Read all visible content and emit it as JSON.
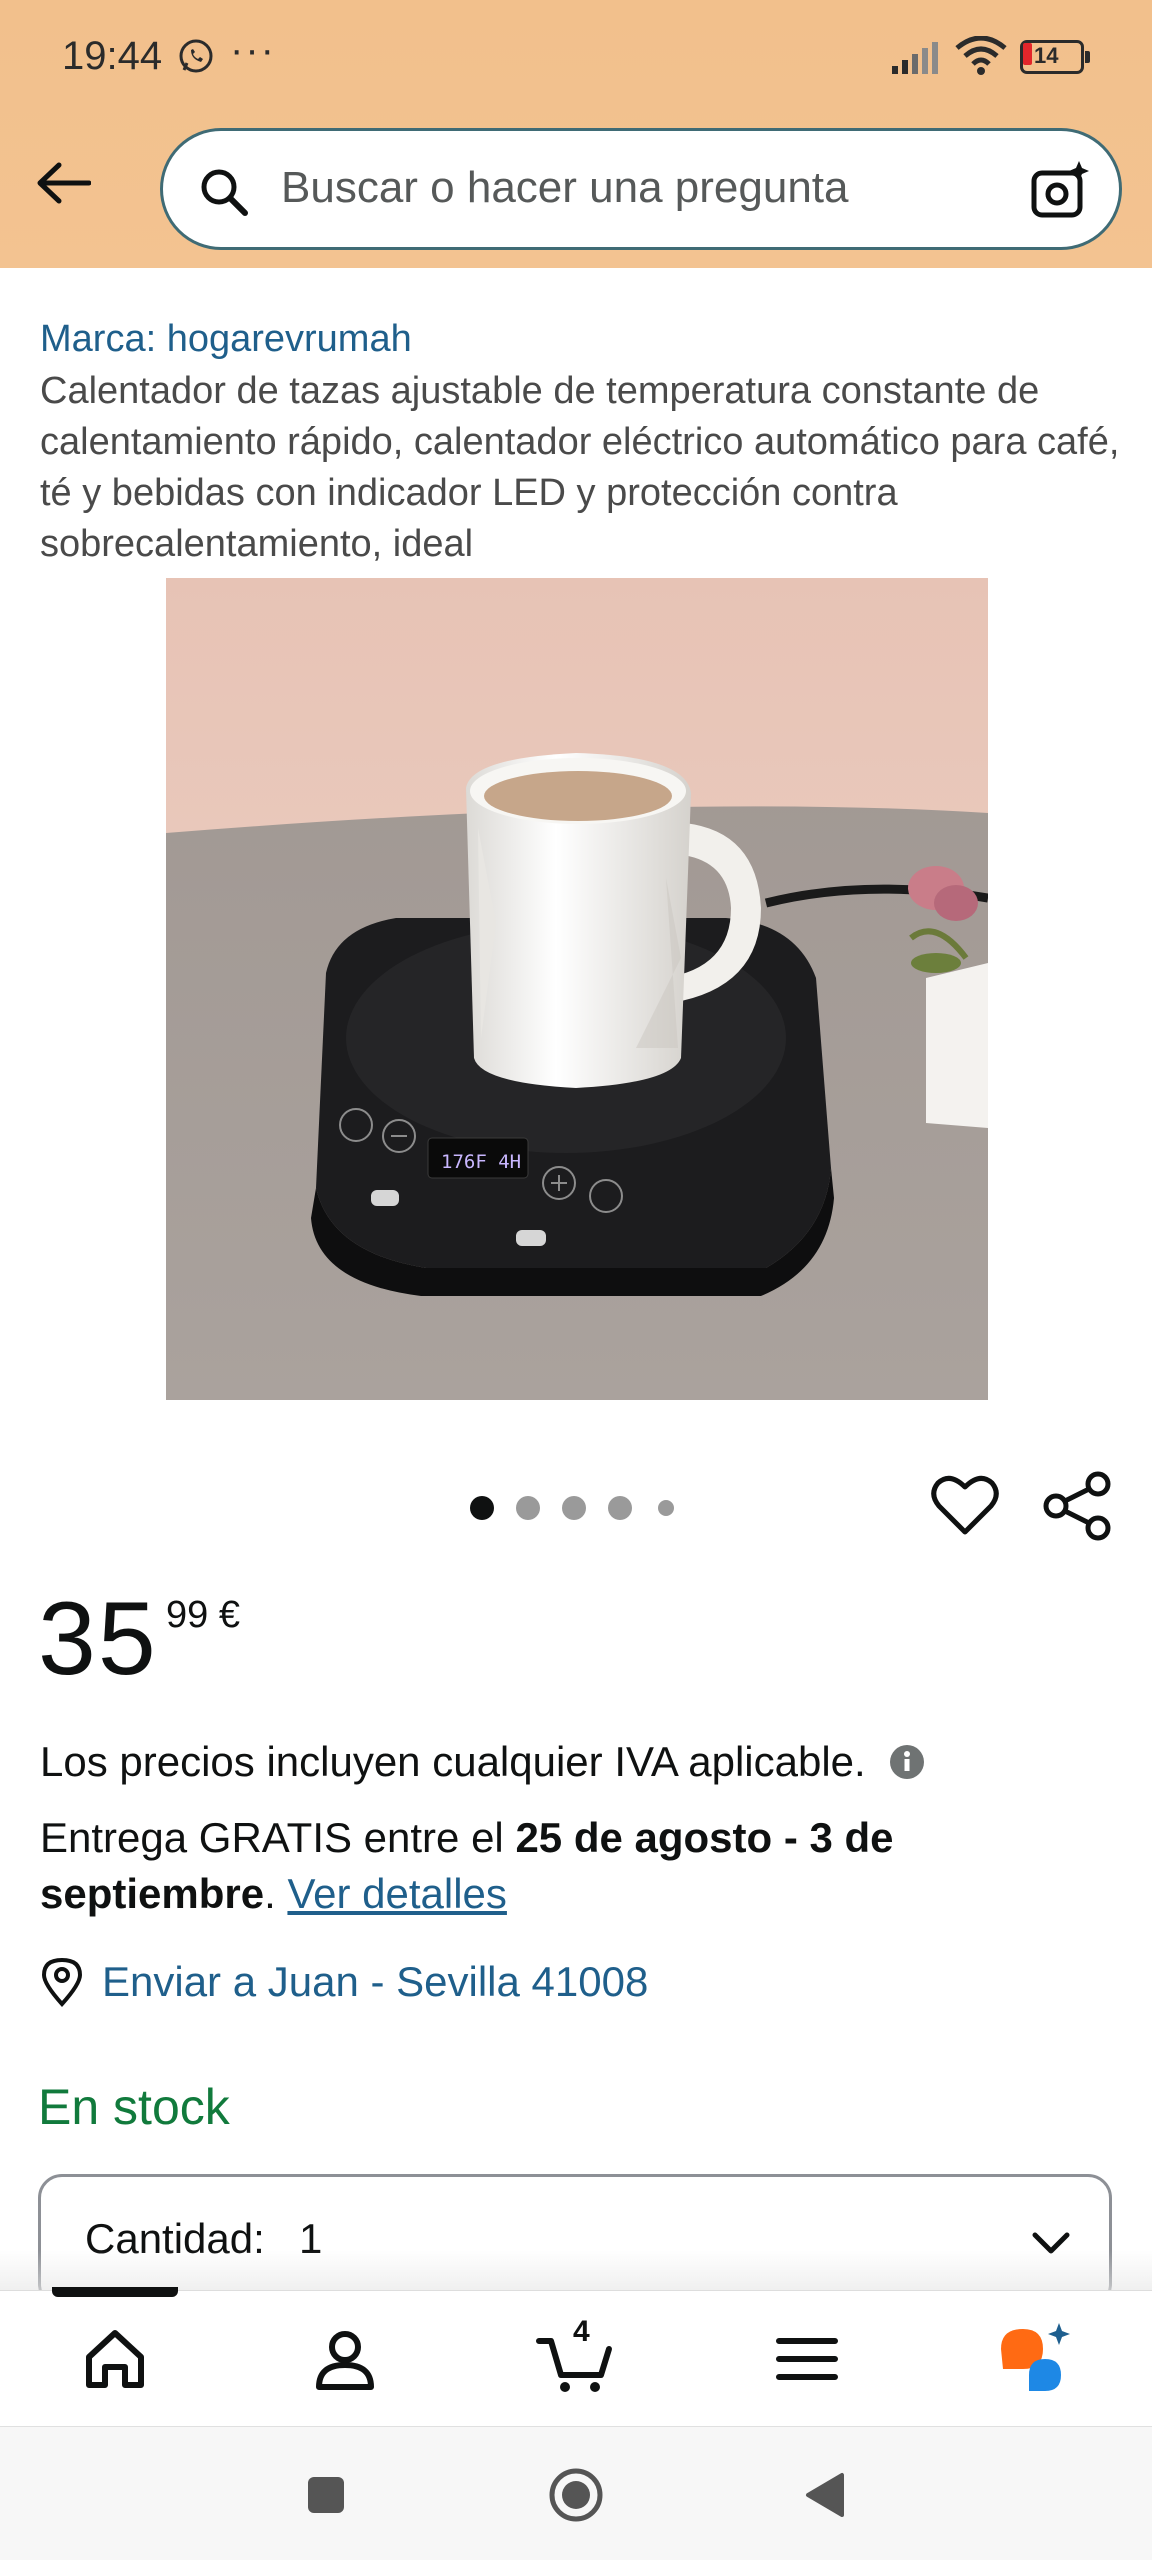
{
  "status_bar": {
    "time": "19:44",
    "overflow_dots": "···",
    "battery_level": "14"
  },
  "search": {
    "placeholder": "Buscar o hacer una pregunta"
  },
  "product": {
    "brand_link": "Marca: hogarevrumah",
    "title": "Calentador de tazas ajustable de temperatura constante de calentamiento rápido, calentador eléctrico automático para café, té y bebidas con indicador LED y protección contra sobrecalentamiento, ideal",
    "image_display_text": "176F 4H",
    "carousel": {
      "total_dots": 5,
      "active_index": 0
    }
  },
  "price": {
    "whole": "35",
    "fraction": "99 €"
  },
  "vat_text": "Los precios incluyen cualquier IVA aplicable.",
  "delivery": {
    "prefix": "Entrega GRATIS entre el ",
    "dates": "25 de agosto - 3 de septiembre",
    "suffix": ". ",
    "details_link": "Ver detalles"
  },
  "ship_to": "Enviar a Juan - Sevilla 41008",
  "stock_status": "En stock",
  "quantity": {
    "label": "Cantidad:",
    "value": "1"
  },
  "bottom_nav": {
    "cart_count": "4",
    "items": [
      "home-icon",
      "account-icon",
      "cart-icon",
      "menu-icon",
      "rufus-icon"
    ]
  },
  "colors": {
    "header_bg": "#f2c08c",
    "link": "#1f5f8b",
    "stock_green": "#117a3c",
    "battery_low": "#e3262b",
    "rufus_orange": "#ff6a13",
    "rufus_blue": "#1e88e5"
  }
}
